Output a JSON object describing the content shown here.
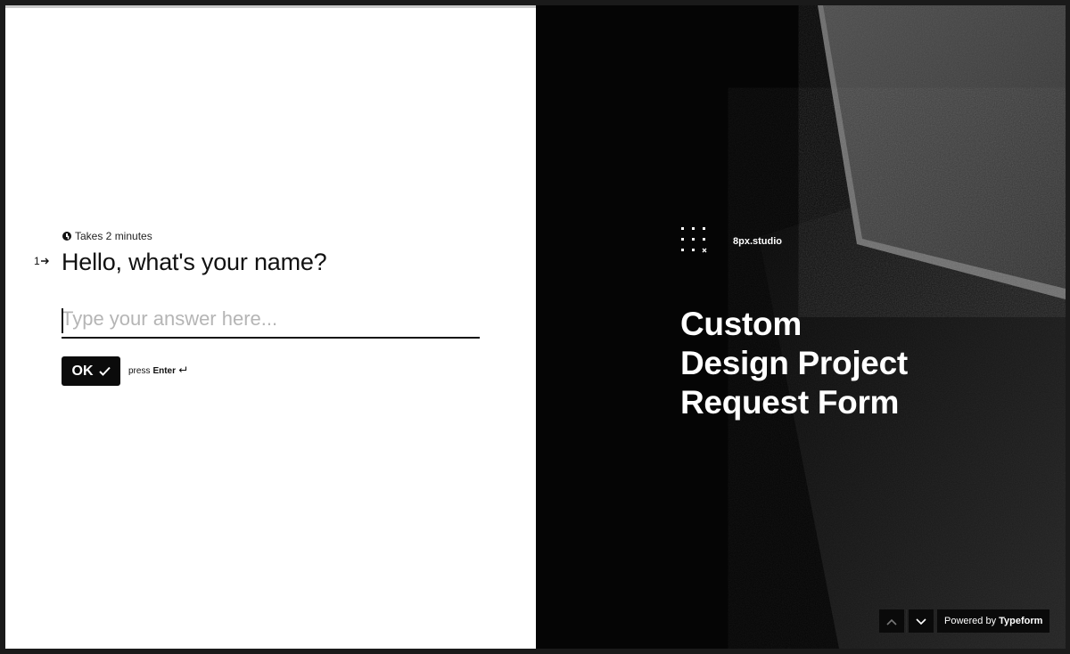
{
  "form": {
    "meta_text": "Takes 2 minutes",
    "question_number": "1",
    "question_title": "Hello, what's your name?",
    "answer_placeholder": "Type your answer here...",
    "ok_label": "OK",
    "press_label": "press",
    "enter_label": "Enter"
  },
  "hero": {
    "brand_name": "8px.studio",
    "title_lines": [
      "Custom",
      "Design Project",
      "Request Form"
    ]
  },
  "footer": {
    "powered_by": "Powered by",
    "powered_brand": "Typeform"
  },
  "colors": {
    "accent": "#0b0b0b",
    "background_left": "#ffffff",
    "background_right": "#050505"
  }
}
